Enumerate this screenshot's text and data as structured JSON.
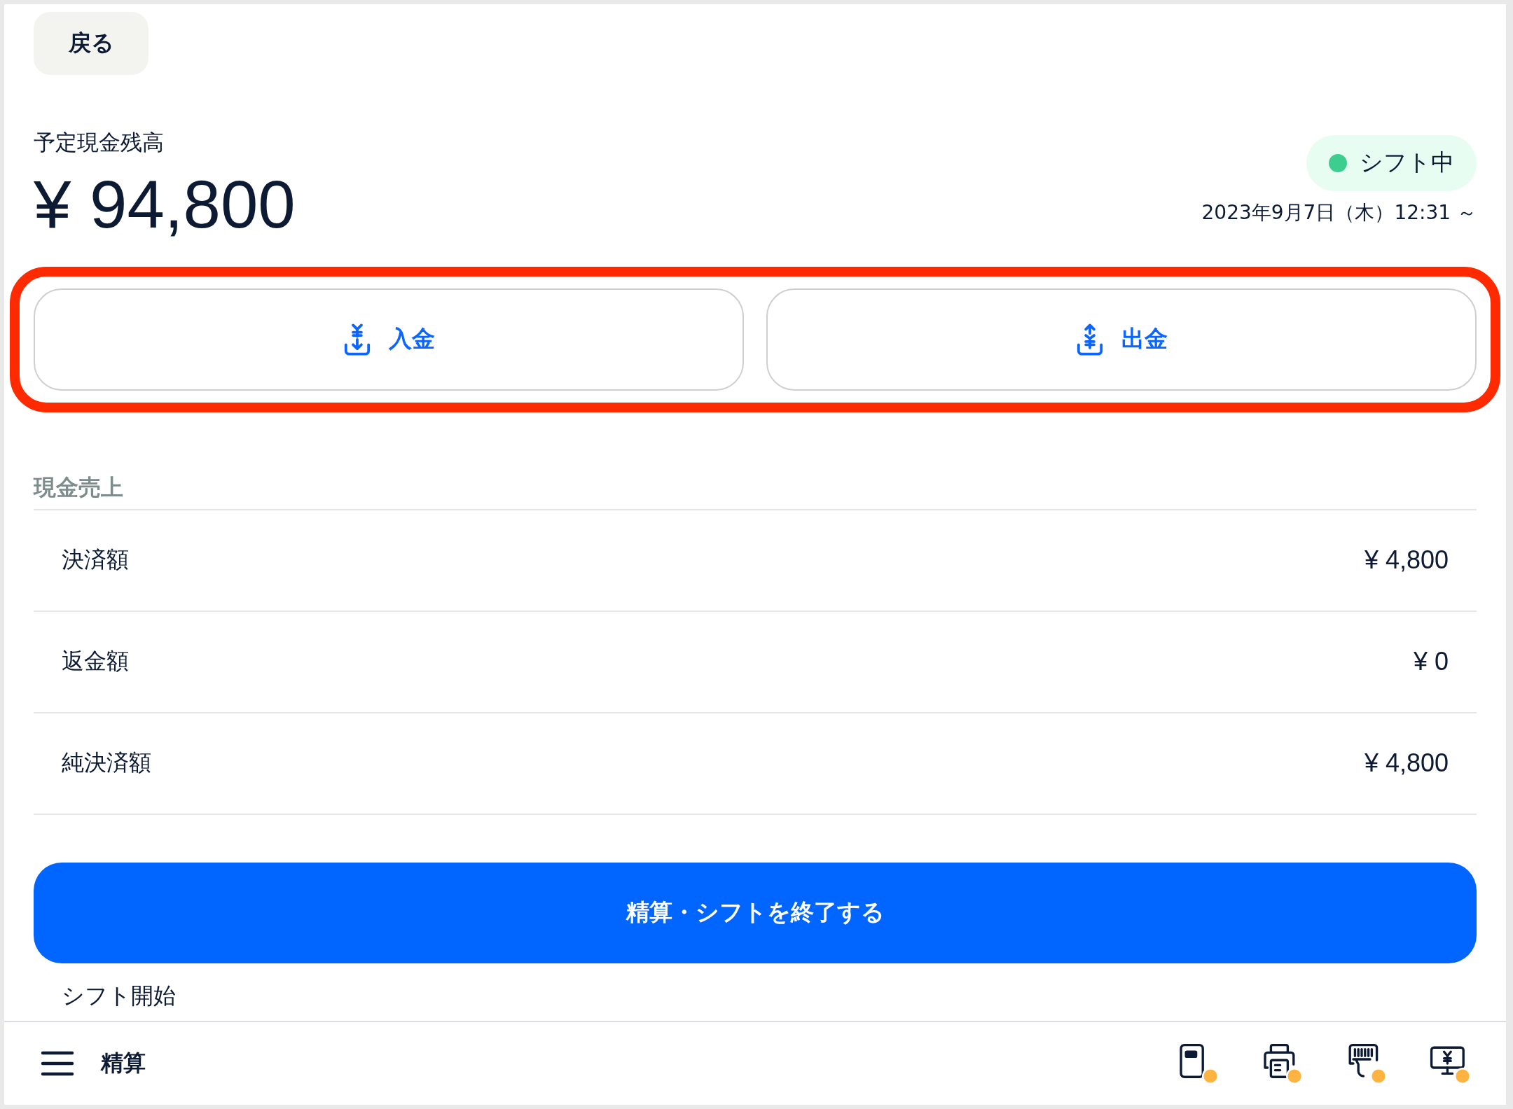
{
  "back_button": {
    "label": "戻る"
  },
  "balance": {
    "label": "予定現金残高",
    "amount": "¥ 94,800"
  },
  "shift_status": {
    "label": "シフト中",
    "color": "#3ccd8f",
    "since": "2023年9月7日（木）12:31 ～"
  },
  "cash_buttons": [
    {
      "kind": "deposit",
      "label": "入金"
    },
    {
      "kind": "withdraw",
      "label": "出金"
    }
  ],
  "cash_sales": {
    "title": "現金売上",
    "rows": [
      {
        "label": "決済額",
        "value": "¥ 4,800"
      },
      {
        "label": "返金額",
        "value": "¥ 0"
      },
      {
        "label": "純決済額",
        "value": "¥ 4,800"
      }
    ]
  },
  "close_button": {
    "label": "精算・シフトを終了する"
  },
  "next_section": {
    "title": "シフト開始"
  },
  "footer": {
    "title": "精算",
    "device_icons": [
      {
        "kind": "reader",
        "color": "#ffb340"
      },
      {
        "kind": "printer",
        "color": "#ffb340"
      },
      {
        "kind": "scanner",
        "color": "#ffb340"
      },
      {
        "kind": "display",
        "color": "#ffb340"
      }
    ]
  }
}
